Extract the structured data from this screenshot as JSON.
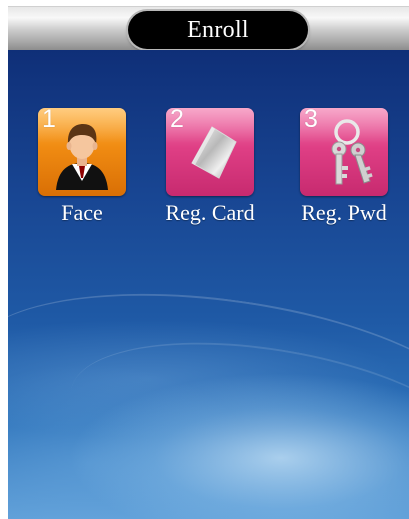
{
  "header": {
    "title": "Enroll"
  },
  "apps": [
    {
      "number": "1",
      "label": "Face",
      "icon": "person-icon",
      "color": "#f08b12"
    },
    {
      "number": "2",
      "label": "Reg. Card",
      "icon": "card-icon",
      "color": "#df3f85"
    },
    {
      "number": "3",
      "label": "Reg. Pwd",
      "icon": "keys-icon",
      "color": "#df3f85"
    }
  ]
}
